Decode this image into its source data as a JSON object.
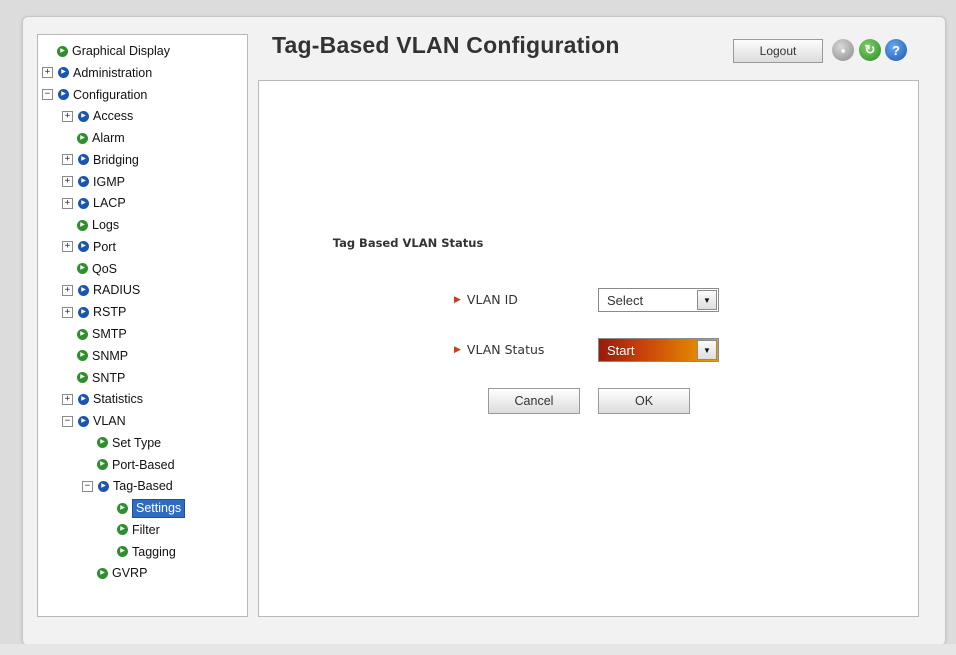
{
  "header": {
    "title": "Tag-Based VLAN Configuration",
    "logout_label": "Logout"
  },
  "toolbar_icons": [
    "save-icon",
    "refresh-icon",
    "help-icon"
  ],
  "nav": [
    {
      "label": "Graphical Display",
      "level": 0,
      "toggle": "",
      "icon": "green"
    },
    {
      "label": "Administration",
      "level": 0,
      "toggle": "+",
      "icon": "blue"
    },
    {
      "label": "Configuration",
      "level": 0,
      "toggle": "−",
      "icon": "blue"
    },
    {
      "label": "Access",
      "level": 1,
      "toggle": "+",
      "icon": "blue"
    },
    {
      "label": "Alarm",
      "level": 1,
      "toggle": "",
      "icon": "green"
    },
    {
      "label": "Bridging",
      "level": 1,
      "toggle": "+",
      "icon": "blue"
    },
    {
      "label": "IGMP",
      "level": 1,
      "toggle": "+",
      "icon": "blue"
    },
    {
      "label": "LACP",
      "level": 1,
      "toggle": "+",
      "icon": "blue"
    },
    {
      "label": "Logs",
      "level": 1,
      "toggle": "",
      "icon": "green"
    },
    {
      "label": "Port",
      "level": 1,
      "toggle": "+",
      "icon": "blue"
    },
    {
      "label": "QoS",
      "level": 1,
      "toggle": "",
      "icon": "green"
    },
    {
      "label": "RADIUS",
      "level": 1,
      "toggle": "+",
      "icon": "blue"
    },
    {
      "label": "RSTP",
      "level": 1,
      "toggle": "+",
      "icon": "blue"
    },
    {
      "label": "SMTP",
      "level": 1,
      "toggle": "",
      "icon": "green"
    },
    {
      "label": "SNMP",
      "level": 1,
      "toggle": "",
      "icon": "green"
    },
    {
      "label": "SNTP",
      "level": 1,
      "toggle": "",
      "icon": "green"
    },
    {
      "label": "Statistics",
      "level": 1,
      "toggle": "+",
      "icon": "blue"
    },
    {
      "label": "VLAN",
      "level": 1,
      "toggle": "−",
      "icon": "blue"
    },
    {
      "label": "Set Type",
      "level": 2,
      "toggle": "",
      "icon": "green"
    },
    {
      "label": "Port-Based",
      "level": 2,
      "toggle": "",
      "icon": "green"
    },
    {
      "label": "Tag-Based",
      "level": 2,
      "toggle": "−",
      "icon": "blue"
    },
    {
      "label": "Settings",
      "level": 3,
      "toggle": "",
      "icon": "green",
      "selected": true
    },
    {
      "label": "Filter",
      "level": 3,
      "toggle": "",
      "icon": "green"
    },
    {
      "label": "Tagging",
      "level": 3,
      "toggle": "",
      "icon": "green"
    },
    {
      "label": "GVRP",
      "level": 2,
      "toggle": "",
      "icon": "green"
    }
  ],
  "form": {
    "section_title": "Tag Based VLAN Status",
    "vlan_id_label": "VLAN ID",
    "vlan_id_value": "Select",
    "vlan_status_label": "VLAN Status",
    "vlan_status_value": "Start",
    "cancel_label": "Cancel",
    "ok_label": "OK"
  },
  "colors": {
    "accent_blue": "#1a55b0",
    "accent_green": "#2f8f2f",
    "selection": "#2e6cc2",
    "status_start": "#9a1a0a",
    "status_end": "#eda000"
  }
}
